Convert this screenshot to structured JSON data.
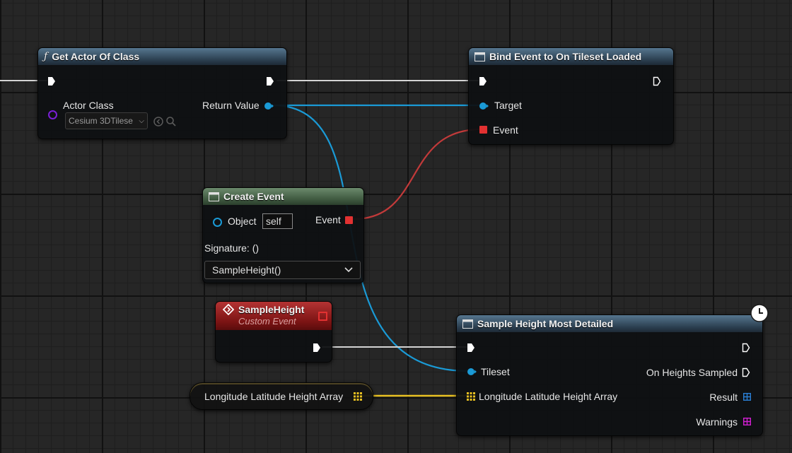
{
  "get_actor": {
    "title": "Get Actor Of Class",
    "actor_class_label": "Actor Class",
    "actor_class_value": "Cesium 3DTilese",
    "return_value_label": "Return Value"
  },
  "bind_event": {
    "title": "Bind Event to On Tileset Loaded",
    "target_label": "Target",
    "event_label": "Event"
  },
  "create_event": {
    "title": "Create Event",
    "object_label": "Object",
    "object_value": "self",
    "event_label": "Event",
    "signature_label": "Signature: ()",
    "function_value": "SampleHeight()"
  },
  "custom_event": {
    "title": "SampleHeight",
    "subtitle": "Custom Event"
  },
  "variable": {
    "label": "Longitude Latitude Height Array"
  },
  "sample_height": {
    "title": "Sample Height Most Detailed",
    "tileset_label": "Tileset",
    "array_label": "Longitude Latitude Height Array",
    "on_heights_label": "On Heights Sampled",
    "result_label": "Result",
    "warnings_label": "Warnings"
  },
  "colors": {
    "object_pin": "#1a9ad6",
    "delegate_pin": "#e23131",
    "exec_pin": "#ffffff",
    "array_pin": "#e8c021",
    "result_pin": "#2a7fd4",
    "warnings_pin": "#d21fd2",
    "class_pin": "#7a1fd6"
  }
}
